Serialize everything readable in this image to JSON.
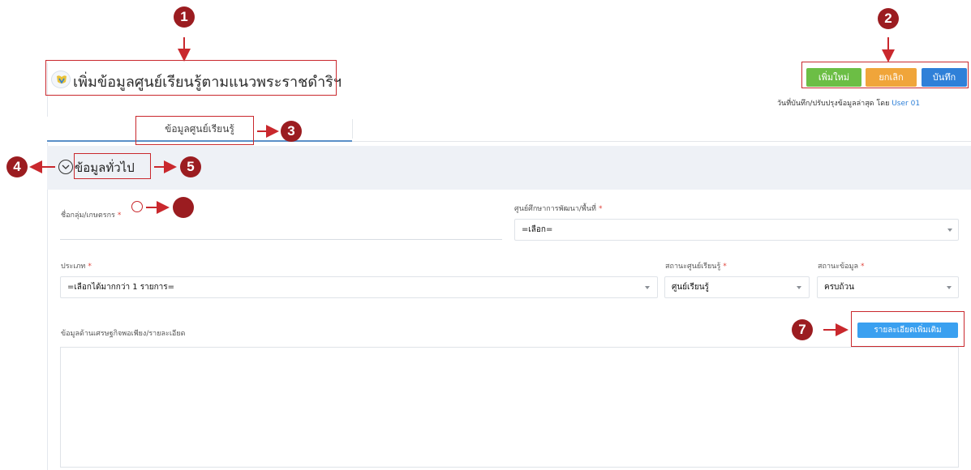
{
  "header": {
    "title": "เพิ่มข้อมูลศูนย์เรียนรู้ตามแนวพระราชดำริฯ",
    "new_label": "เพิ่มใหม่",
    "cancel_label": "ยกเลิก",
    "save_label": "บันทึก",
    "last_updated_prefix": "วันที่บันทึก/ปรับปรุงข้อมูลล่าสุด โดย ",
    "last_updated_user": "User 01"
  },
  "tabs": [
    {
      "label": "ข้อมูลศูนย์เรียนรู้",
      "active": true
    }
  ],
  "section": {
    "title": "ข้อมูลทั่วไป",
    "collapse_icon": "chevron-down-circle-icon"
  },
  "form": {
    "group_name": {
      "label": "ชื่อกลุ่ม/เกษตรกร",
      "required": "*",
      "value": ""
    },
    "dev_center": {
      "label": "ศูนย์ศึกษาการพัฒนา/พื้นที่",
      "required": "*",
      "value": "=เลือก="
    },
    "type": {
      "label": "ประเภท",
      "required": "*",
      "value": "=เลือกได้มากกว่า 1 รายการ="
    },
    "center_status": {
      "label": "สถานะศูนย์เรียนรู้",
      "required": "*",
      "value": "ศูนย์เรียนรู้"
    },
    "data_status": {
      "label": "สถานะข้อมูล",
      "required": "*",
      "value": "ครบถ้วน"
    },
    "sufficiency": {
      "label": "ข้อมูลด้านเศรษฐกิจพอเพียง/รายละเอียด",
      "value": ""
    },
    "more_details_label": "รายละเอียดเพิ่มเติม"
  },
  "annotations": {
    "markers": [
      "1",
      "2",
      "3",
      "4",
      "5",
      "7"
    ],
    "color": "#c9282d",
    "marker_fill": "#9b1c20"
  },
  "colors": {
    "new": "#6cbe45",
    "cancel": "#f0a53a",
    "save": "#2f80d8",
    "details": "#3aa0f0",
    "section_bg": "#eef1f6",
    "required": "#e0453d"
  }
}
